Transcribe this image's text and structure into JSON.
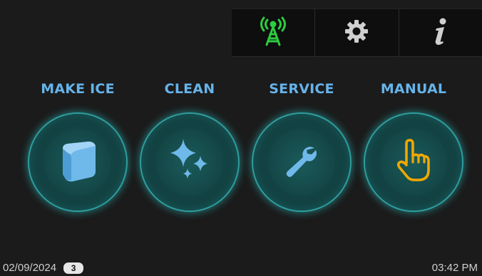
{
  "toolbar": {
    "items": [
      {
        "icon": "antenna-icon",
        "color": "#2ecc40"
      },
      {
        "icon": "gear-icon",
        "color": "#cfcfcf"
      },
      {
        "icon": "info-icon",
        "color": "#cfcfcf"
      }
    ]
  },
  "modes": [
    {
      "label": "MAKE ICE",
      "icon": "ice-cube-icon"
    },
    {
      "label": "CLEAN",
      "icon": "sparkle-icon"
    },
    {
      "label": "SERVICE",
      "icon": "wrench-icon"
    },
    {
      "label": "MANUAL",
      "icon": "hand-pointer-icon"
    }
  ],
  "colors": {
    "label": "#66b3ea",
    "manual_icon": "#f0a800",
    "ring": "#2f9ea0"
  },
  "footer": {
    "date": "02/09/2024",
    "badge": "3",
    "time": "03:42 PM"
  }
}
